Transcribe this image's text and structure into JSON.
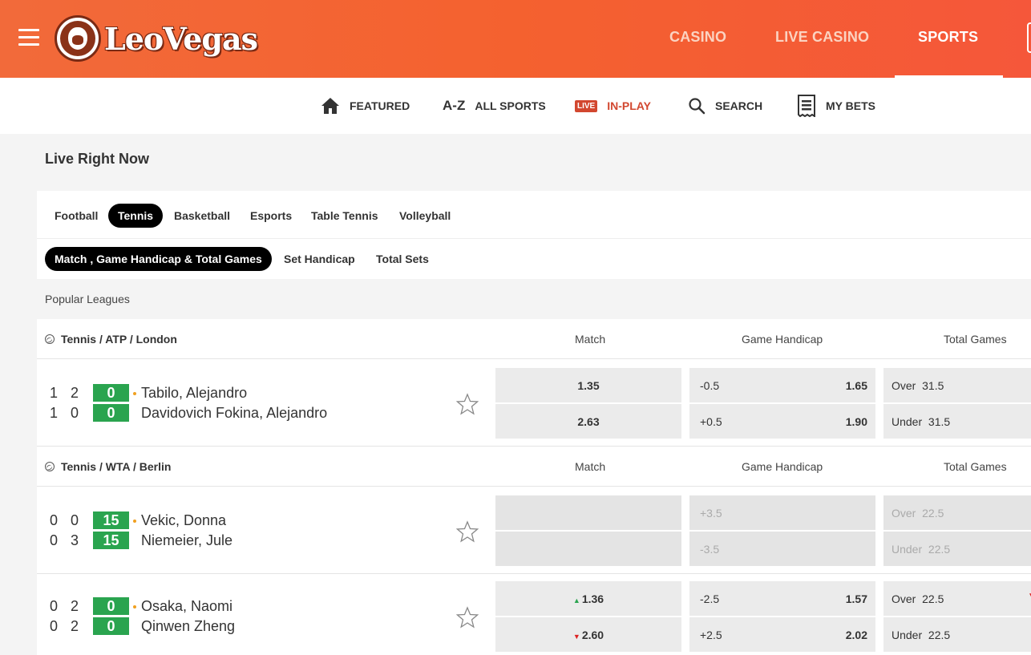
{
  "header": {
    "brand": "LeoVegas",
    "nav": [
      {
        "label": "CASINO",
        "active": false
      },
      {
        "label": "LIVE CASINO",
        "active": false
      },
      {
        "label": "SPORTS",
        "active": true
      }
    ]
  },
  "subnav": {
    "items": [
      {
        "label": "FEATURED",
        "icon": "home-icon"
      },
      {
        "label": "ALL SPORTS",
        "icon": "az-icon",
        "icon_text": "A-Z"
      },
      {
        "label": "IN-PLAY",
        "icon": "live-icon",
        "icon_text": "LIVE",
        "active": true
      },
      {
        "label": "SEARCH",
        "icon": "search-icon"
      },
      {
        "label": "MY BETS",
        "icon": "betslip-icon"
      }
    ]
  },
  "page_title": "Live Right Now",
  "sport_tabs": [
    "Football",
    "Tennis",
    "Basketball",
    "Esports",
    "Table Tennis",
    "Volleyball"
  ],
  "active_sport": "Tennis",
  "market_tabs": [
    "Match , Game Handicap & Total Games",
    "Set Handicap",
    "Total Sets"
  ],
  "active_market": "Match , Game Handicap & Total Games",
  "popular_label": "Popular Leagues",
  "columns": {
    "match": "Match",
    "handicap": "Game Handicap",
    "total": "Total Games"
  },
  "leagues": [
    {
      "name": "Tennis / ATP / London",
      "matches": [
        {
          "p1": {
            "name": "Tabilo, Alejandro",
            "s1": "1",
            "s2": "2",
            "pts": "0",
            "serving": true
          },
          "p2": {
            "name": "Davidovich Fokina, Alejandro",
            "s1": "1",
            "s2": "0",
            "pts": "0"
          },
          "match_odds": [
            "1.35",
            "2.63"
          ],
          "handicap": [
            {
              "line": "-0.5",
              "odd": "1.65"
            },
            {
              "line": "+0.5",
              "odd": "1.90"
            }
          ],
          "totals": [
            {
              "label": "Over",
              "line": "31.5"
            },
            {
              "label": "Under",
              "line": "31.5"
            }
          ]
        }
      ]
    },
    {
      "name": "Tennis / WTA / Berlin",
      "matches": [
        {
          "p1": {
            "name": "Vekic, Donna",
            "s1": "0",
            "s2": "0",
            "pts": "15",
            "serving": true
          },
          "p2": {
            "name": "Niemeier, Jule",
            "s1": "0",
            "s2": "3",
            "pts": "15"
          },
          "match_odds": [
            "",
            ""
          ],
          "handicap": [
            {
              "line": "+3.5",
              "odd": ""
            },
            {
              "line": "-3.5",
              "odd": ""
            }
          ],
          "totals": [
            {
              "label": "Over",
              "line": "22.5"
            },
            {
              "label": "Under",
              "line": "22.5"
            }
          ],
          "suspended": true
        },
        {
          "p1": {
            "name": "Osaka, Naomi",
            "s1": "0",
            "s2": "2",
            "pts": "0",
            "serving": true
          },
          "p2": {
            "name": "Qinwen Zheng",
            "s1": "0",
            "s2": "2",
            "pts": "0"
          },
          "match_odds": [
            "1.36",
            "2.60"
          ],
          "match_trend": [
            "up",
            "down"
          ],
          "handicap": [
            {
              "line": "-2.5",
              "odd": "1.57"
            },
            {
              "line": "+2.5",
              "odd": "2.02"
            }
          ],
          "totals": [
            {
              "label": "Over",
              "line": "22.5"
            },
            {
              "label": "Under",
              "line": "22.5"
            }
          ]
        }
      ]
    }
  ],
  "colors": {
    "brand_orange": "#f4612f",
    "live_red": "#d2472f",
    "point_green": "#2aa44f"
  }
}
